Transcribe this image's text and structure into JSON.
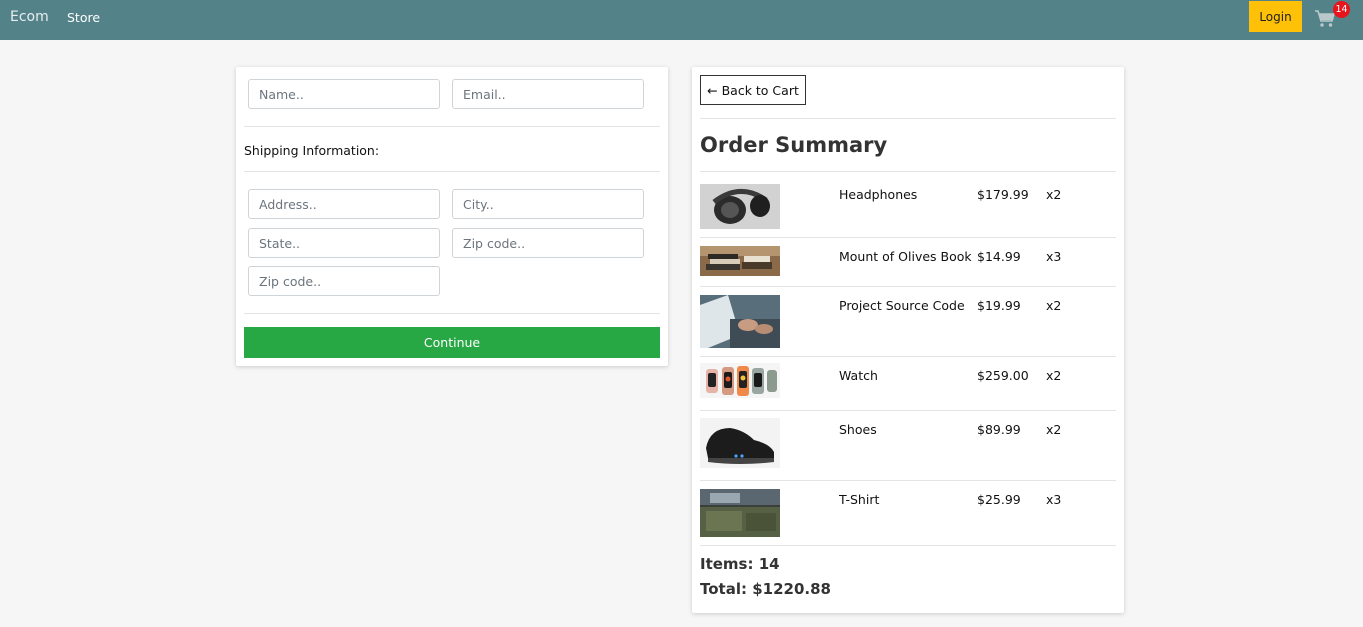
{
  "navbar": {
    "brand": "Ecom",
    "store_link": "Store",
    "login_label": "Login",
    "cart_count": "14"
  },
  "form": {
    "name_placeholder": "Name..",
    "email_placeholder": "Email..",
    "shipping_label": "Shipping Information:",
    "address_placeholder": "Address..",
    "city_placeholder": "City..",
    "state_placeholder": "State..",
    "zip_placeholder": "Zip code..",
    "zip2_placeholder": "Zip code..",
    "continue_label": "Continue"
  },
  "summary": {
    "back_label": "← Back to Cart",
    "title": "Order Summary",
    "items": [
      {
        "name": "Headphones",
        "price": "$179.99",
        "qty": "x2",
        "image": "headphones-image"
      },
      {
        "name": "Mount of Olives Book",
        "price": "$14.99",
        "qty": "x3",
        "image": "book-image"
      },
      {
        "name": "Project Source Code",
        "price": "$19.99",
        "qty": "x2",
        "image": "laptop-image"
      },
      {
        "name": "Watch",
        "price": "$259.00",
        "qty": "x2",
        "image": "watch-image"
      },
      {
        "name": "Shoes",
        "price": "$89.99",
        "qty": "x2",
        "image": "shoes-image"
      },
      {
        "name": "T-Shirt",
        "price": "$25.99",
        "qty": "x3",
        "image": "tshirt-image"
      }
    ],
    "items_total": "Items: 14",
    "total": "Total: $1220.88"
  }
}
